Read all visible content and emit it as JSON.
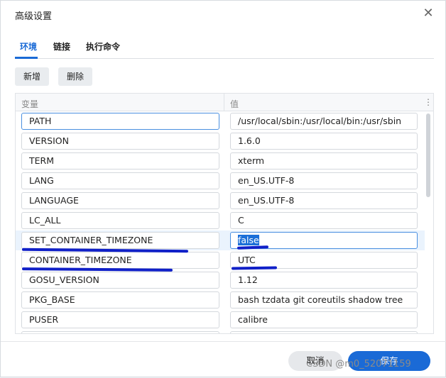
{
  "dialog": {
    "title": "高级设置",
    "close_icon": "close-icon"
  },
  "tabs": [
    {
      "label": "环境",
      "active": true
    },
    {
      "label": "链接",
      "active": false
    },
    {
      "label": "执行命令",
      "active": false
    }
  ],
  "toolbar": {
    "add_label": "新增",
    "delete_label": "删除"
  },
  "table": {
    "columns": [
      "变量",
      "值"
    ],
    "menu_icon": "vertical-dots-icon",
    "rows": [
      {
        "key": "PATH",
        "value": "/usr/local/sbin:/usr/local/bin:/usr/sbin"
      },
      {
        "key": "VERSION",
        "value": "1.6.0"
      },
      {
        "key": "TERM",
        "value": "xterm"
      },
      {
        "key": "LANG",
        "value": "en_US.UTF-8"
      },
      {
        "key": "LANGUAGE",
        "value": "en_US.UTF-8"
      },
      {
        "key": "LC_ALL",
        "value": "C"
      },
      {
        "key": "SET_CONTAINER_TIMEZONE",
        "value": "false"
      },
      {
        "key": "CONTAINER_TIMEZONE",
        "value": "UTC"
      },
      {
        "key": "GOSU_VERSION",
        "value": "1.12"
      },
      {
        "key": "PKG_BASE",
        "value": "bash tzdata git coreutils shadow tree"
      },
      {
        "key": "PUSER",
        "value": "calibre"
      }
    ]
  },
  "footer": {
    "cancel_label": "取消",
    "save_label": "保存",
    "watermark": "CSDN @m0_52071159"
  },
  "colors": {
    "accent": "#1a6ad6",
    "selected_row": "#eaf3fd",
    "annotation_ink": "#1020c8"
  }
}
